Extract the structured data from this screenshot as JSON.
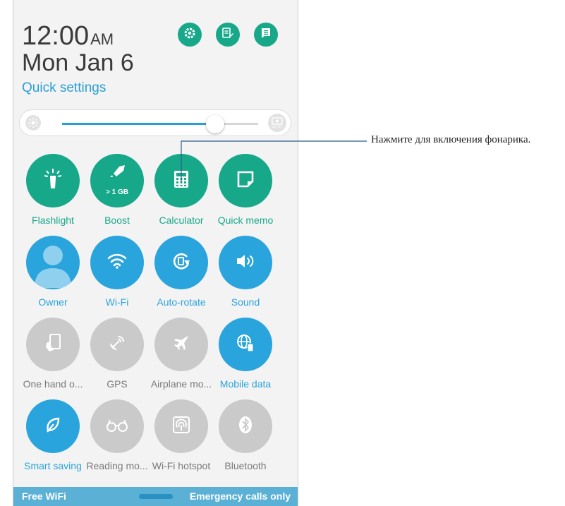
{
  "status": {
    "time": "12:00",
    "ampm": "AM",
    "date": "Mon Jan 6"
  },
  "quick_settings_label": "Quick settings",
  "header_buttons": [
    {
      "icon": "settings-gear-icon"
    },
    {
      "icon": "edit-list-icon"
    },
    {
      "icon": "notes-list-icon"
    }
  ],
  "brightness": {
    "level": 0.78,
    "auto_label": "AUTO"
  },
  "tiles": [
    {
      "label": "Flashlight",
      "state": "green",
      "icon": "flashlight-icon"
    },
    {
      "label": "Boost",
      "state": "green",
      "icon": "rocket-icon",
      "sub": "> 1 GB"
    },
    {
      "label": "Calculator",
      "state": "green",
      "icon": "calculator-icon"
    },
    {
      "label": "Quick memo",
      "state": "green",
      "icon": "memo-icon"
    },
    {
      "label": "Owner",
      "state": "blue",
      "icon": "owner-avatar-icon"
    },
    {
      "label": "Wi-Fi",
      "state": "blue",
      "icon": "wifi-icon"
    },
    {
      "label": "Auto-rotate",
      "state": "blue",
      "icon": "auto-rotate-icon"
    },
    {
      "label": "Sound",
      "state": "blue",
      "icon": "sound-icon"
    },
    {
      "label": "One hand o...",
      "state": "gray",
      "icon": "one-hand-icon"
    },
    {
      "label": "GPS",
      "state": "gray",
      "icon": "gps-icon"
    },
    {
      "label": "Airplane mo...",
      "state": "gray",
      "icon": "airplane-icon"
    },
    {
      "label": "Mobile data",
      "state": "blue",
      "icon": "mobile-data-icon"
    },
    {
      "label": "Smart saving",
      "state": "blue",
      "icon": "leaf-icon"
    },
    {
      "label": "Reading mo...",
      "state": "gray",
      "icon": "glasses-icon"
    },
    {
      "label": "Wi-Fi hotspot",
      "state": "gray",
      "icon": "hotspot-icon"
    },
    {
      "label": "Bluetooth",
      "state": "gray",
      "icon": "bluetooth-icon"
    }
  ],
  "footer": {
    "left": "Free WiFi",
    "right": "Emergency calls only"
  },
  "callout": {
    "text": "Нажмите для включения фонарика."
  },
  "colors": {
    "green": "#17a88a",
    "blue": "#2aa4dc",
    "gray": "#cacaca",
    "link": "#2a9fd6"
  }
}
